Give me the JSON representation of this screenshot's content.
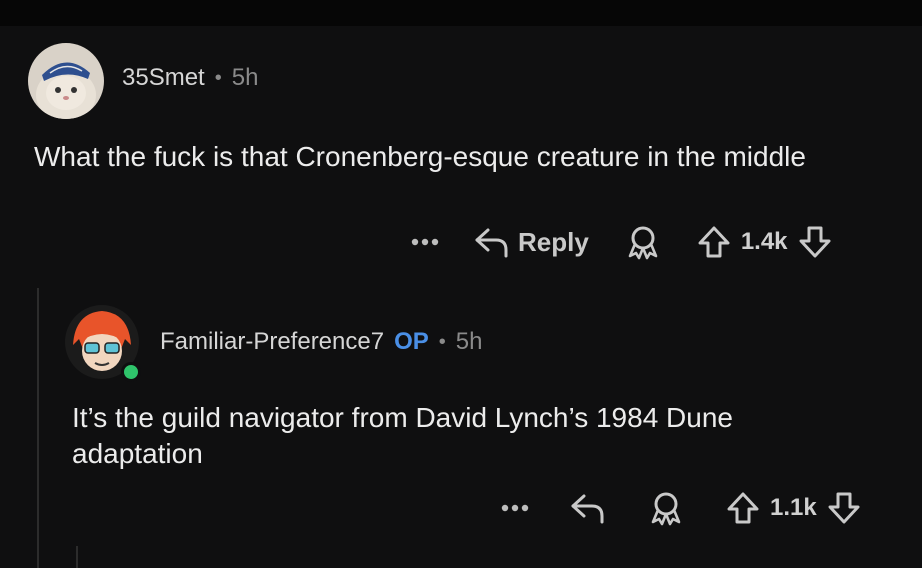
{
  "comments": [
    {
      "author": "35Smet",
      "op_badge": "",
      "time": "5h",
      "text": "What the fuck is that Cronenberg-esque creature in the middle",
      "reply_label": "Reply",
      "score": "1.4k",
      "avatar_icon": "cat-avatar-icon"
    },
    {
      "author": "Familiar-Preference7",
      "op_badge": "OP",
      "time": "5h",
      "text": "It’s the guild navigator from David Lynch’s 1984 Dune adaptation",
      "score": "1.1k",
      "avatar_icon": "anime-avatar-icon"
    }
  ],
  "separator": "•",
  "colors": {
    "background": "#0f0f10",
    "op_badge": "#4a8fe6",
    "online_indicator": "#2fc46b"
  }
}
